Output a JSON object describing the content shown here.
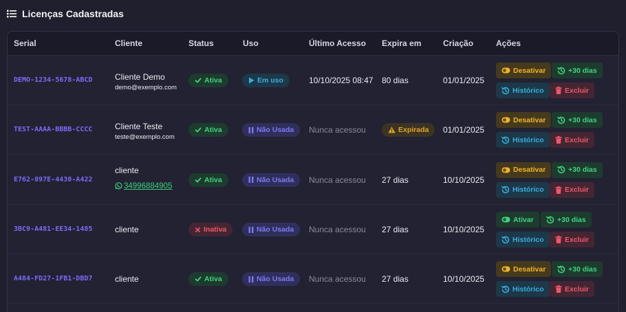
{
  "header": {
    "title": "Licenças Cadastradas"
  },
  "table": {
    "columns": [
      "Serial",
      "Cliente",
      "Status",
      "Uso",
      "Último Acesso",
      "Expira em",
      "Criação",
      "Ações"
    ],
    "rows": [
      {
        "serial": "DEMO-1234-5678-ABCD",
        "client_name": "Cliente Demo",
        "client_email": "demo@exemplo.com",
        "client_phone": "",
        "status": "Ativa",
        "status_kind": "ativa",
        "usage": "Em uso",
        "usage_kind": "emuso",
        "last_access": "10/10/2025 08:47",
        "last_access_muted": false,
        "expires": "80 dias",
        "expires_kind": "text",
        "created": "01/01/2025",
        "toggle_label": "Desativar",
        "toggle_kind": "desativar"
      },
      {
        "serial": "TEST-AAAA-BBBB-CCCC",
        "client_name": "Cliente Teste",
        "client_email": "teste@exemplo.com",
        "client_phone": "",
        "status": "Ativa",
        "status_kind": "ativa",
        "usage": "Não Usada",
        "usage_kind": "naousada",
        "last_access": "Nunca acessou",
        "last_access_muted": true,
        "expires": "Expirada",
        "expires_kind": "badge",
        "created": "01/01/2025",
        "toggle_label": "Desativar",
        "toggle_kind": "desativar"
      },
      {
        "serial": "E762-897E-4430-A422",
        "client_name": "cliente",
        "client_email": "",
        "client_phone": "34996884905",
        "status": "Ativa",
        "status_kind": "ativa",
        "usage": "Não Usada",
        "usage_kind": "naousada",
        "last_access": "Nunca acessou",
        "last_access_muted": true,
        "expires": "27 dias",
        "expires_kind": "text",
        "created": "10/10/2025",
        "toggle_label": "Desativar",
        "toggle_kind": "desativar"
      },
      {
        "serial": "3BC9-A481-EE34-1485",
        "client_name": "cliente",
        "client_email": "",
        "client_phone": "",
        "status": "Inativa",
        "status_kind": "inativa",
        "usage": "Não Usada",
        "usage_kind": "naousada",
        "last_access": "Nunca acessou",
        "last_access_muted": true,
        "expires": "27 dias",
        "expires_kind": "text",
        "created": "10/10/2025",
        "toggle_label": "Ativar",
        "toggle_kind": "ativar"
      },
      {
        "serial": "A484-FD27-1FB1-DBD7",
        "client_name": "cliente",
        "client_email": "",
        "client_phone": "",
        "status": "Ativa",
        "status_kind": "ativa",
        "usage": "Não Usada",
        "usage_kind": "naousada",
        "last_access": "Nunca acessou",
        "last_access_muted": true,
        "expires": "27 dias",
        "expires_kind": "text",
        "created": "10/10/2025",
        "toggle_label": "Desativar",
        "toggle_kind": "desativar"
      }
    ]
  },
  "actions": {
    "plus30_label": "+30 dias",
    "history_label": "Histórico",
    "delete_label": "Excluir"
  },
  "icons": {
    "header": "list-icon",
    "status_active": "check-icon",
    "status_inactive": "x-icon",
    "usage_in_use": "play-icon",
    "usage_unused": "pause-icon",
    "expired": "warning-icon",
    "toggle": "toggle-icon",
    "plus30": "history-plus-icon",
    "history": "history-icon",
    "delete": "trash-icon",
    "phone": "whatsapp-icon"
  },
  "colors": {
    "background": "#1f1f2d",
    "serial": "#7b6bf5",
    "active": "#3ed47f",
    "inactive": "#f0566b",
    "in_use": "#3aaedc",
    "unused": "#7d79f2",
    "warning": "#e2a42f",
    "toggle_off": "#f0b423"
  }
}
